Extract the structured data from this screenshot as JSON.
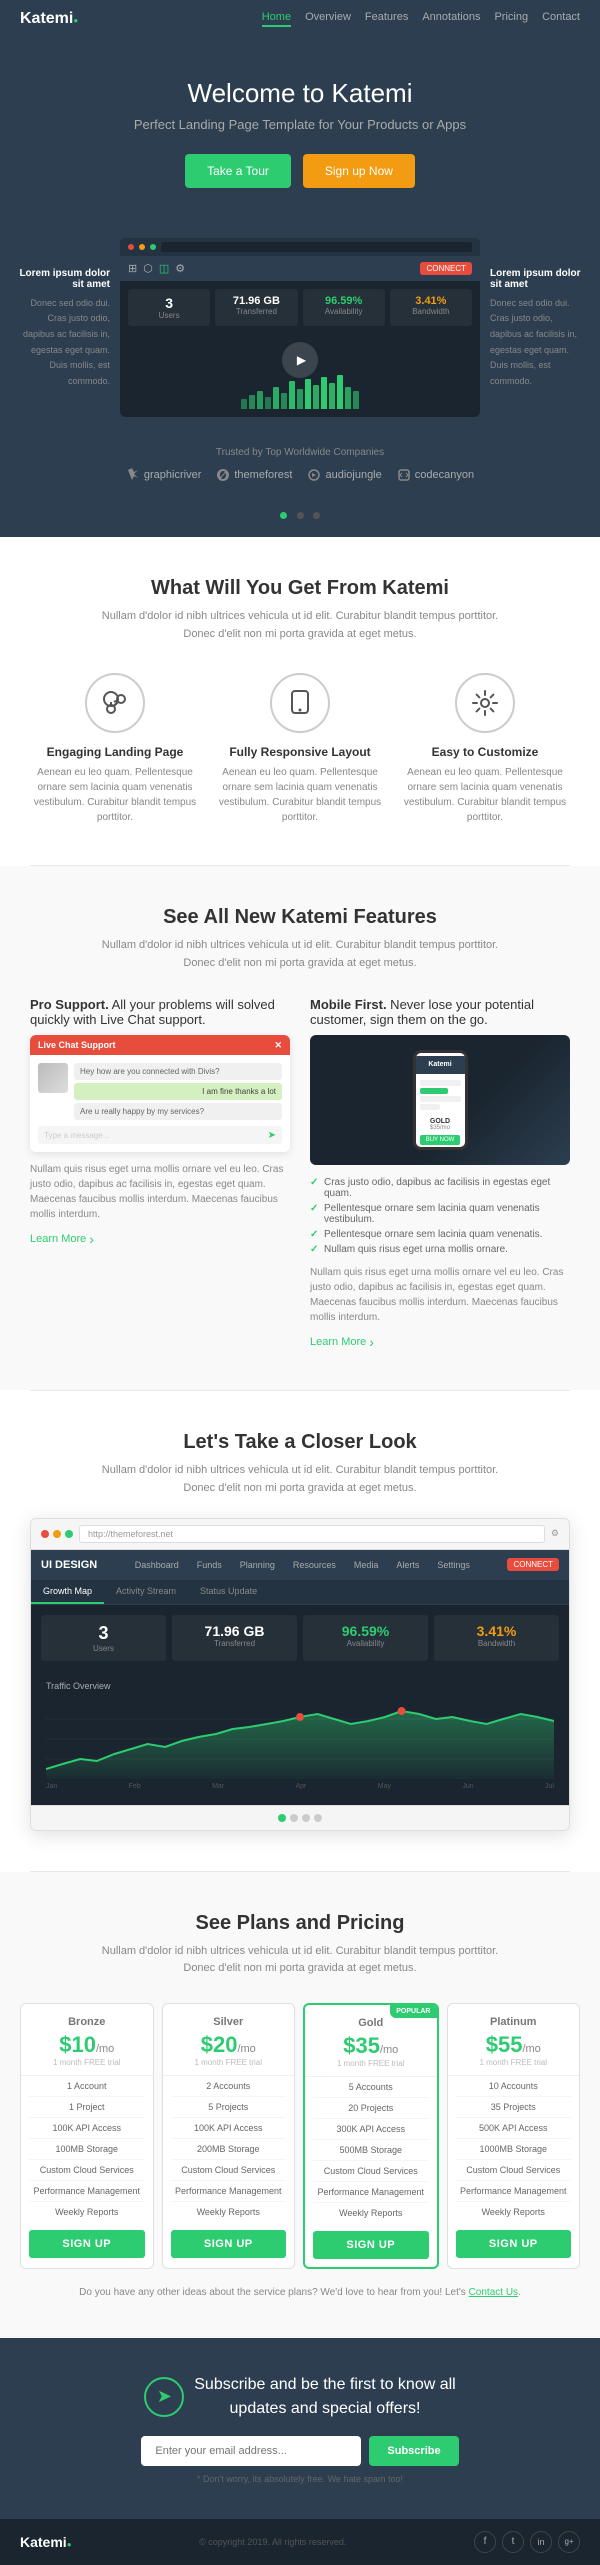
{
  "nav": {
    "logo": "Katemi",
    "logo_dot": "●",
    "links": [
      "Home",
      "Overview",
      "Features",
      "Annotations",
      "Pricing",
      "Contact"
    ],
    "active": "Home"
  },
  "hero": {
    "title_pre": "Welcome to ",
    "title_bold": "Katemi",
    "subtitle": "Perfect Landing Page Template for Your Products or Apps",
    "btn_tour": "Take a Tour",
    "btn_signup": "Sign up Now"
  },
  "demo": {
    "left_title": "Lorem ipsum dolor sit amet",
    "left_text": "Donec sed odio dui. Cras justo odio, dapibus ac facilisis in, egestas eget quam. Duis mollis, est commodo.",
    "right_title": "Lorem ipsum dolor sit amet",
    "right_text": "Donec sed odio dui. Cras justo odio, dapibus ac facilisis in, egestas eget quam. Duis mollis, est commodo."
  },
  "trusted": {
    "label": "Trusted by Top Worldwide Companies",
    "logos": [
      "graphicriver",
      "themeforest",
      "audiojungle",
      "codecanyon"
    ]
  },
  "what_you_get": {
    "title": "What Will You Get From Katemi",
    "subtitle": "Nullam d'dolor id nibh ultrices vehicula ut id elit. Curabitur blandit tempus porttitor. Donec d'elit non mi porta gravida at eget metus.",
    "features": [
      {
        "icon": "⤢",
        "title": "Engaging Landing Page",
        "desc": "Aenean eu leo quam. Pellentesque ornare sem lacinia quam venenatis vestibulum. Curabitur blandit tempus porttitor."
      },
      {
        "icon": "📱",
        "title": "Fully Responsive Layout",
        "desc": "Aenean eu leo quam. Pellentesque ornare sem lacinia quam venenatis vestibulum. Curabitur blandit tempus porttitor."
      },
      {
        "icon": "⚙",
        "title": "Easy to Customize",
        "desc": "Aenean eu leo quam. Pellentesque ornare sem lacinia quam venenatis vestibulum. Curabitur blandit tempus porttitor."
      }
    ]
  },
  "katemi_features": {
    "title": "See All New Katemi Features",
    "subtitle": "Nullam d'dolor id nibh ultrices vehicula ut id elit. Curabitur blandit tempus porttitor. Donec d'elit non mi porta gravida at eget metus.",
    "col1": {
      "title_pre": "Pro Support.",
      "title_body": " All your problems will solved quickly with Live Chat support.",
      "body": "Nullam quis risus eget urna mollis ornare vel eu leo. Cras justo odio, dapibus ac facilisis in, egestas eget quam. Maecenas faucibus mollis interdum. Maecenas faucibus mollis interdum.",
      "learn_more": "Learn More",
      "chat_header": "Live Chat Support",
      "chat_msgs": [
        "Hey how are you connected with Divis?",
        "I am fine thanks a lot",
        "Are u really happy by my services?"
      ]
    },
    "col2": {
      "title_pre": "Mobile First.",
      "title_body": " Never lose your potential customer, sign them on the go.",
      "body": "Nullam quis risus eget urna mollis ornare vel eu leo. Cras justo odio, dapibus ac facilisis in, egestas eget quam. Maecenas faucibus mollis interdum. Maecenas faucibus mollis interdum.",
      "learn_more": "Learn More",
      "check_items": [
        "Cras justo odio, dapibus ac facilisis in egestas eget quam.",
        "Pellentesque ornare sem lacinia quam venenatis vestibulum.",
        "Pellentesque ornare sem lacinia quam venenatis.",
        "Nullam quis risus eget urna mollis ornare."
      ]
    }
  },
  "closer_look": {
    "title": "Let's Take a Closer Look",
    "subtitle": "Nullam d'dolor id nibh ultrices vehicula ut id elit. Curabitur blandit tempus porttitor. Donec d'elit non mi porta gravida at eget metus.",
    "browser_url": "http://themeforest.net",
    "app_nav": [
      "Dashboard",
      "Funds",
      "Planning",
      "Resources",
      "Media",
      "Alerts",
      "Settings"
    ],
    "sub_nav": [
      "Growth Map",
      "Activity Stream",
      "Status Update"
    ],
    "stats": [
      {
        "num": "3",
        "label": "Users"
      },
      {
        "num": "71.96 GB",
        "label": "Transferred"
      },
      {
        "num": "96.59%",
        "label": "Availability"
      },
      {
        "num": "3.41%",
        "label": "Bandwidth"
      }
    ],
    "chart_title": "Traffic Overview",
    "bars": [
      2,
      3,
      4,
      3,
      5,
      4,
      6,
      5,
      7,
      6,
      8,
      7,
      9,
      8,
      10,
      9,
      11,
      10,
      12,
      11,
      9,
      8,
      10,
      9,
      8,
      7,
      9,
      10,
      11,
      12
    ]
  },
  "pricing": {
    "title": "See Plans and Pricing",
    "subtitle": "Nullam d'dolor id nibh ultrices vehicula ut id elit. Curabitur blandit tempus porttitor. Donec d'elit non mi porta gravida at eget metus.",
    "plans": [
      {
        "name": "Bronze",
        "price": "$10",
        "period": "/mo",
        "trial": "1 month FREE trial",
        "featured": false,
        "features": [
          "1 Account",
          "1 Project",
          "100K API Access",
          "100MB Storage",
          "Custom Cloud Services",
          "Performance Management",
          "Weekly Reports"
        ],
        "btn": "SIGN UP"
      },
      {
        "name": "Silver",
        "price": "$20",
        "period": "/mo",
        "trial": "1 month FREE trial",
        "featured": false,
        "features": [
          "2 Accounts",
          "5 Projects",
          "100K API Access",
          "200MB Storage",
          "Custom Cloud Services",
          "Performance Management",
          "Weekly Reports"
        ],
        "btn": "SIGN UP"
      },
      {
        "name": "Gold",
        "price": "$35",
        "period": "/mo",
        "trial": "1 month FREE trial",
        "featured": true,
        "badge": "POPULAR",
        "features": [
          "5 Accounts",
          "20 Projects",
          "300K API Access",
          "500MB Storage",
          "Custom Cloud Services",
          "Performance Management",
          "Weekly Reports"
        ],
        "btn": "SIGN UP"
      },
      {
        "name": "Platinum",
        "price": "$55",
        "period": "/mo",
        "trial": "1 month FREE trial",
        "featured": false,
        "features": [
          "10 Accounts",
          "35 Projects",
          "500K API Access",
          "1000MB Storage",
          "Custom Cloud Services",
          "Performance Management",
          "Weekly Reports"
        ],
        "btn": "SIGN UP"
      }
    ],
    "note_pre": "Do you have any other ideas about the service plans? We'd love to hear from you! Let's ",
    "note_link": "Contact Us",
    "note_post": "."
  },
  "subscribe": {
    "title_pre": "Subscribe and be the first to know all\nupdates and ",
    "title_bold": "special offers!",
    "input_placeholder": "Enter your email address...",
    "btn": "Subscribe",
    "note": "* Don't worry, its absolutely free. We hate spam too!"
  },
  "footer": {
    "logo": "Katemi",
    "copy": "© copyright 2019. All rights reserved.",
    "social": [
      "f",
      "t",
      "in",
      "g+"
    ]
  }
}
